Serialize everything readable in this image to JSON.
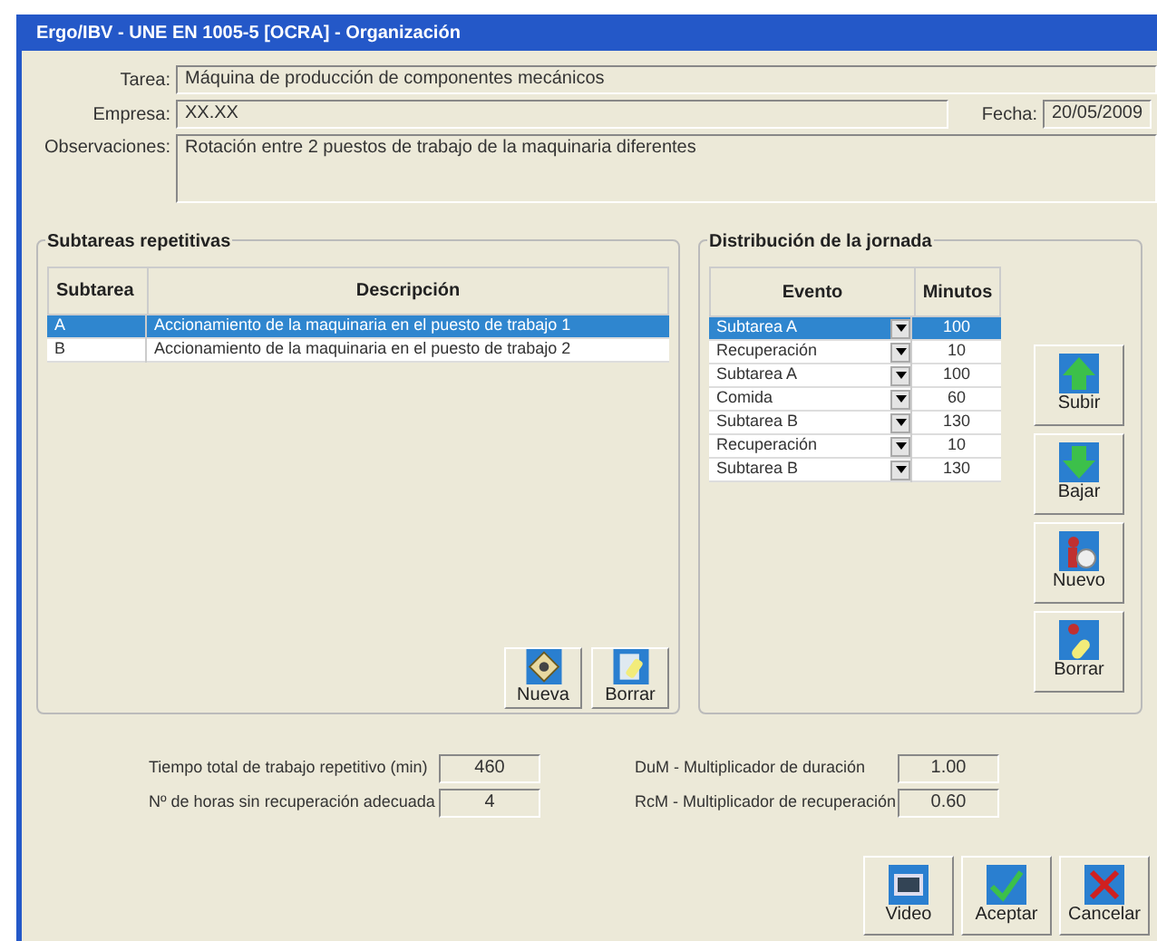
{
  "window": {
    "title": "Ergo/IBV - UNE EN 1005-5 [OCRA] - Organización"
  },
  "fields": {
    "tarea": {
      "label": "Tarea:",
      "value": "Máquina de producción de componentes mecánicos"
    },
    "empresa": {
      "label": "Empresa:",
      "value": "XX.XX"
    },
    "fecha": {
      "label": "Fecha:",
      "value": "20/05/2009"
    },
    "observaciones": {
      "label": "Observaciones:",
      "value": "Rotación entre 2 puestos de trabajo de la maquinaria diferentes"
    }
  },
  "subtareas": {
    "title": "Subtareas repetitivas",
    "columns": [
      "Subtarea",
      "Descripción"
    ],
    "rows": [
      {
        "subtarea": "A",
        "descripcion": "Accionamiento de la maquinaria en el puesto de trabajo 1",
        "selected": true
      },
      {
        "subtarea": "B",
        "descripcion": "Accionamiento de la maquinaria en el puesto de trabajo 2",
        "selected": false
      }
    ],
    "buttons": [
      {
        "kind": "new",
        "label": "Nueva"
      },
      {
        "kind": "delete",
        "label": "Borrar"
      }
    ]
  },
  "jornada": {
    "title": "Distribución de la jornada",
    "columns": [
      "Evento",
      "Minutos"
    ],
    "rows": [
      {
        "evento": "Subtarea A",
        "minutos": "100",
        "selected": true
      },
      {
        "evento": "Recuperación",
        "minutos": "10",
        "selected": false
      },
      {
        "evento": "Subtarea A",
        "minutos": "100",
        "selected": false
      },
      {
        "evento": "Comida",
        "minutos": "60",
        "selected": false
      },
      {
        "evento": "Subtarea B",
        "minutos": "130",
        "selected": false
      },
      {
        "evento": "Recuperación",
        "minutos": "10",
        "selected": false
      },
      {
        "evento": "Subtarea B",
        "minutos": "130",
        "selected": false
      }
    ],
    "buttons": [
      {
        "kind": "up",
        "label": "Subir"
      },
      {
        "kind": "down",
        "label": "Bajar"
      },
      {
        "kind": "new-person",
        "label": "Nuevo"
      },
      {
        "kind": "erase",
        "label": "Borrar"
      }
    ]
  },
  "results": [
    {
      "label": "Tiempo total de trabajo repetitivo (min)",
      "value": "460"
    },
    {
      "label": "Nº de horas sin recuperación adecuada",
      "value": "4"
    },
    {
      "label": "DuM - Multiplicador de duración",
      "value": "1.00"
    },
    {
      "label": "RcM - Multiplicador de recuperación",
      "value": "0.60"
    }
  ],
  "footer_buttons": [
    {
      "kind": "video",
      "label": "Video"
    },
    {
      "kind": "accept",
      "label": "Aceptar"
    },
    {
      "kind": "cancel",
      "label": "Cancelar"
    }
  ]
}
